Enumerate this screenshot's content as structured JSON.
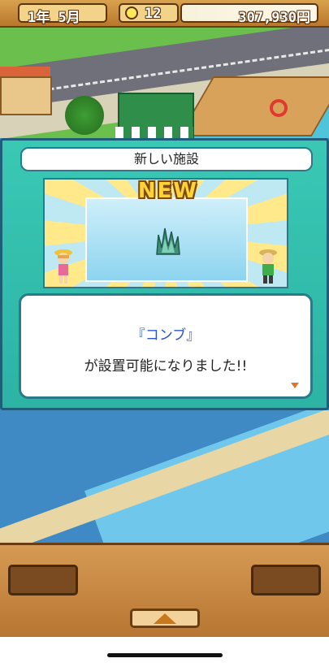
{
  "top_bar": {
    "date": "1年 5月",
    "idea_points": "12",
    "money": "307,930円",
    "bulb_icon": "lightbulb-icon"
  },
  "dialog": {
    "title": "新しい施設",
    "new_label": "NEW",
    "item_name": "『コンブ』",
    "message": "が設置可能になりました!!"
  },
  "colors": {
    "panel": "#2fbba9",
    "item_text": "#2a54c8",
    "wood": "#c98a44"
  }
}
